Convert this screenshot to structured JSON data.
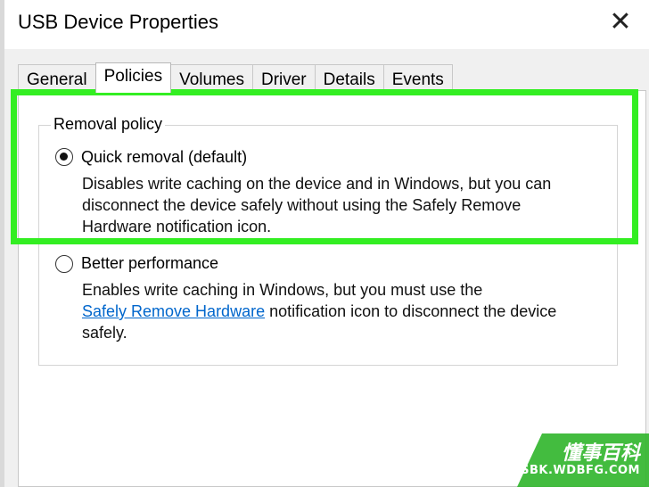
{
  "window": {
    "title": "USB Device Properties",
    "close_glyph": "✕"
  },
  "tabs": [
    {
      "label": "General"
    },
    {
      "label": "Policies",
      "active": true
    },
    {
      "label": "Volumes"
    },
    {
      "label": "Driver"
    },
    {
      "label": "Details"
    },
    {
      "label": "Events"
    }
  ],
  "removal_policy": {
    "group_label": "Removal policy",
    "options": [
      {
        "label": "Quick removal (default)",
        "selected": true,
        "description": [
          "Disables write caching on the device and in Windows, but you can",
          "disconnect the device safely without using the Safely Remove",
          "Hardware notification icon."
        ]
      },
      {
        "label": "Better performance",
        "selected": false,
        "description_line1": "Enables write caching in Windows, but you must use the",
        "link_text": "Safely Remove Hardware",
        "description_line2_rest": " notification icon to disconnect the device",
        "description_line3": "safely."
      }
    ]
  },
  "highlight_color": "#33ee22",
  "watermark": {
    "chinese": "懂事百科",
    "url": "DSBK.WDBFG.COM",
    "color": "#2fb52a"
  }
}
